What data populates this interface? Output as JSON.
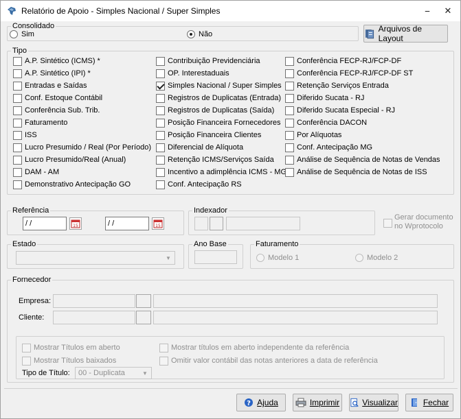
{
  "window": {
    "title": "Relatório de Apoio - Simples Nacional / Super Simples",
    "minimize_glyph": "⎯",
    "close_glyph": "✕"
  },
  "consolidado": {
    "legend": "Consolidado",
    "options": [
      {
        "label": "Sim",
        "selected": false
      },
      {
        "label": "Não",
        "selected": true
      }
    ]
  },
  "layout_button": {
    "label": "Arquivos de Layout"
  },
  "tipo": {
    "legend": "Tipo",
    "col1": [
      {
        "label": "A.P. Sintético (ICMS) *",
        "checked": false
      },
      {
        "label": "A.P. Sintético (IPI) *",
        "checked": false
      },
      {
        "label": "Entradas e Saídas",
        "checked": false
      },
      {
        "label": "Conf. Estoque Contábil",
        "checked": false
      },
      {
        "label": "Conferência Sub. Trib.",
        "checked": false
      },
      {
        "label": "Faturamento",
        "checked": false
      },
      {
        "label": "ISS",
        "checked": false
      },
      {
        "label": "Lucro Presumido / Real (Por  Período)",
        "checked": false
      },
      {
        "label": "Lucro Presumido/Real (Anual)",
        "checked": false
      },
      {
        "label": "DAM - AM",
        "checked": false
      },
      {
        "label": "Demonstrativo Antecipação GO",
        "checked": false
      }
    ],
    "col2": [
      {
        "label": "Contribuição Previdenciária",
        "checked": false
      },
      {
        "label": "OP. Interestaduais",
        "checked": false
      },
      {
        "label": "Simples Nacional / Super Simples",
        "checked": true
      },
      {
        "label": "Registros de Duplicatas (Entrada)",
        "checked": false
      },
      {
        "label": "Registros de Duplicatas (Saída)",
        "checked": false
      },
      {
        "label": "Posição Financeira Fornecedores",
        "checked": false
      },
      {
        "label": "Posição Financeira Clientes",
        "checked": false
      },
      {
        "label": "Diferencial de Alíquota",
        "checked": false
      },
      {
        "label": "Retenção ICMS/Serviços Saída",
        "checked": false
      },
      {
        "label": "Incentivo a adimplência ICMS - MG",
        "checked": false
      },
      {
        "label": "Conf. Antecipação RS",
        "checked": false
      }
    ],
    "col3": [
      {
        "label": "Conferência FECP-RJ/FCP-DF",
        "checked": false
      },
      {
        "label": "Conferência FECP-RJ/FCP-DF ST",
        "checked": false
      },
      {
        "label": "Retenção Serviços Entrada",
        "checked": false
      },
      {
        "label": "Diferido Sucata - RJ",
        "checked": false
      },
      {
        "label": "Diferido Sucata Especial - RJ",
        "checked": false
      },
      {
        "label": "Conferência DACON",
        "checked": false
      },
      {
        "label": "Por Alíquotas",
        "checked": false
      },
      {
        "label": "Conf. Antecipação MG",
        "checked": false
      },
      {
        "label": "Análise de Sequência de Notas de Vendas",
        "checked": false
      },
      {
        "label": "Análise de Sequência de Notas de ISS",
        "checked": false
      }
    ]
  },
  "referencia": {
    "legend": "Referência",
    "start": "/ /",
    "end": "/ /",
    "cal_glyph": "15"
  },
  "indexador": {
    "legend": "Indexador",
    "value": ""
  },
  "gerar_doc": {
    "label_line1": "Gerar documento",
    "label_line2": "no Wprotocolo",
    "checked": false
  },
  "estado": {
    "legend": "Estado",
    "value": ""
  },
  "ano_base": {
    "legend": "Ano Base",
    "value": ""
  },
  "faturamento": {
    "legend": "Faturamento",
    "options": [
      {
        "label": "Modelo 1",
        "selected": false
      },
      {
        "label": "Modelo 2",
        "selected": false
      }
    ]
  },
  "fornecedor": {
    "legend": "Fornecedor",
    "empresa_label": "Empresa:",
    "cliente_label": "Cliente:"
  },
  "titulos": {
    "mostrar_aberto": "Mostrar Títulos em aberto",
    "mostrar_baixados": "Mostrar Títulos baixados",
    "mostrar_aberto_indep": "Mostrar títulos em aberto independente da referência",
    "omitir_valor": "Omitir valor contábil das notas anteriores a data de referência",
    "tipo_label": "Tipo de Título:",
    "tipo_value": "00 - Duplicata"
  },
  "buttons": {
    "ajuda": "Ajuda",
    "imprimir": "Imprimir",
    "visualizar": "Visualizar",
    "fechar": "Fechar"
  }
}
